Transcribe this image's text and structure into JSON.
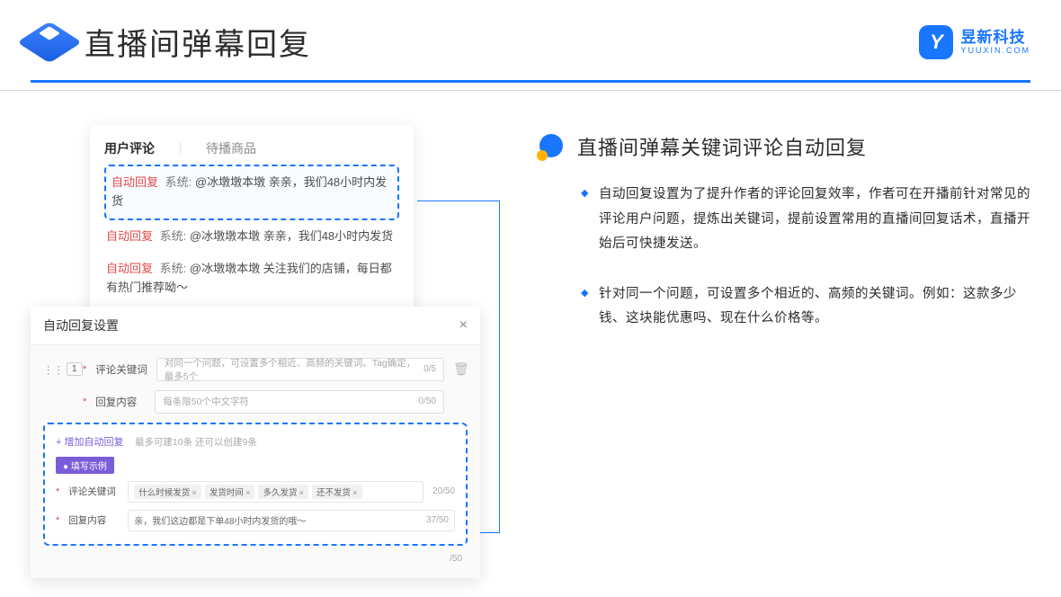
{
  "header": {
    "title": "直播间弹幕回复",
    "brand_cn": "昱新科技",
    "brand_en": "YUUXIN.COM"
  },
  "comments": {
    "tabs": {
      "active": "用户评论",
      "inactive": "待播商品"
    },
    "auto_label": "自动回复",
    "sys_label": "系统:",
    "row1": "@冰墩墩本墩 亲亲，我们48小时内发货",
    "row2": "@冰墩墩本墩 亲亲，我们48小时内发货",
    "row3": "@冰墩墩本墩 关注我们的店铺，每日都有热门推荐呦～"
  },
  "settings": {
    "title": "自动回复设置",
    "num": "1",
    "kw_label": "评论关键词",
    "kw_placeholder": "对同一个问题，可设置多个相近、高频的关键词。Tag确定，最多5个",
    "kw_counter": "0/5",
    "content_label": "回复内容",
    "content_placeholder": "每条限50个中文字符",
    "content_counter": "0/50",
    "add_link": "+ 增加自动回复",
    "add_hint": "最多可建10条 还可以创建9条",
    "example_badge": "● 填写示例",
    "ex_kw_label": "评论关键词",
    "ex_tags": [
      "什么时候发货",
      "发货时间",
      "多久发货",
      "还不发货"
    ],
    "ex_kw_counter": "20/50",
    "ex_content_label": "回复内容",
    "ex_content_value": "亲，我们这边都是下单48小时内发货的哦～",
    "ex_content_counter": "37/50",
    "trail_counter": "/50"
  },
  "right": {
    "section_title": "直播间弹幕关键词评论自动回复",
    "bullet1": "自动回复设置为了提升作者的评论回复效率，作者可在开播前针对常见的评论用户问题，提炼出关键词，提前设置常用的直播间回复话术，直播开始后可快捷发送。",
    "bullet2": "针对同一个问题，可设置多个相近的、高频的关键词。例如：这款多少钱、这块能优惠吗、现在什么价格等。"
  }
}
